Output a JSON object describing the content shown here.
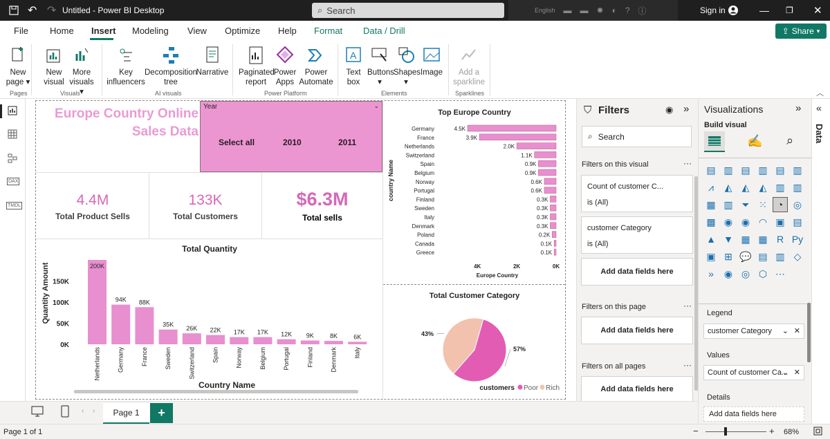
{
  "app": {
    "title": "Untitled - Power BI Desktop",
    "search_placeholder": "Search",
    "language": "English",
    "sign_in": "Sign in"
  },
  "menu": {
    "tabs": [
      "File",
      "Home",
      "Insert",
      "Modeling",
      "View",
      "Optimize",
      "Help",
      "Format",
      "Data / Drill"
    ],
    "active": "Insert",
    "share": "Share"
  },
  "ribbon": {
    "buttons": [
      {
        "label": "New page",
        "lines": [
          "New",
          "page ▾"
        ]
      },
      {
        "label": "New visual",
        "lines": [
          "New",
          "visual"
        ]
      },
      {
        "label": "More visuals",
        "lines": [
          "More",
          "visuals ▾"
        ]
      },
      {
        "label": "Key influencers",
        "lines": [
          "Key",
          "influencers"
        ]
      },
      {
        "label": "Decomposition tree",
        "lines": [
          "Decomposition",
          "tree"
        ]
      },
      {
        "label": "Narrative",
        "lines": [
          "Narrative",
          ""
        ]
      },
      {
        "label": "Paginated report",
        "lines": [
          "Paginated",
          "report"
        ]
      },
      {
        "label": "Power Apps",
        "lines": [
          "Power",
          "Apps"
        ]
      },
      {
        "label": "Power Automate",
        "lines": [
          "Power",
          "Automate"
        ]
      },
      {
        "label": "Text box",
        "lines": [
          "Text",
          "box"
        ]
      },
      {
        "label": "Buttons",
        "lines": [
          "Buttons",
          "▾"
        ]
      },
      {
        "label": "Shapes",
        "lines": [
          "Shapes",
          "▾"
        ]
      },
      {
        "label": "Image",
        "lines": [
          "Image",
          ""
        ]
      },
      {
        "label": "Add a sparkline",
        "lines": [
          "Add a",
          "sparkline"
        ]
      }
    ],
    "groups": [
      "Pages",
      "Visuals",
      "AI visuals",
      "Power Platform",
      "Elements",
      "Sparklines"
    ]
  },
  "report": {
    "title_line1": "Europe Country Online",
    "title_line2": "Sales Data",
    "slicer": {
      "header": "Year",
      "items": [
        "Select all",
        "2010",
        "2011"
      ]
    },
    "kpis": [
      {
        "value": "4.4M",
        "label": "Total Product Sells"
      },
      {
        "value": "133K",
        "label": "Total Customers"
      },
      {
        "value": "$6.3M",
        "label": "Total sells"
      }
    ]
  },
  "chart_data": [
    {
      "type": "bar",
      "title": "Total Quantity",
      "xlabel": "Country Name",
      "ylabel": "Quantity Amount",
      "categories": [
        "Netherlands",
        "Germany",
        "France",
        "Sweden",
        "Switzerland",
        "Spain",
        "Norway",
        "Belgium",
        "Portugal",
        "Finland",
        "Denmark",
        "Italy"
      ],
      "values": [
        200,
        94,
        88,
        35,
        26,
        22,
        17,
        17,
        12,
        9,
        8,
        6
      ],
      "data_labels": [
        "200K",
        "94K",
        "88K",
        "35K",
        "26K",
        "22K",
        "17K",
        "17K",
        "12K",
        "9K",
        "8K",
        "6K"
      ],
      "yticks": [
        "0K",
        "50K",
        "100K",
        "150K"
      ],
      "ylim": [
        0,
        200
      ],
      "color": "#e88fcf"
    },
    {
      "type": "bar",
      "orientation": "horizontal",
      "title": "Top Europe Country",
      "xlabel": "Europe Country",
      "ylabel": "country Name",
      "categories": [
        "Germany",
        "France",
        "Netherlands",
        "Switzerland",
        "Spain",
        "Belgium",
        "Norway",
        "Portugal",
        "Finland",
        "Sweden",
        "Italy",
        "Denmark",
        "Poland",
        "Canada",
        "Greece"
      ],
      "values": [
        4.5,
        3.9,
        2.0,
        1.1,
        0.9,
        0.9,
        0.6,
        0.6,
        0.3,
        0.3,
        0.3,
        0.3,
        0.2,
        0.1,
        0.1
      ],
      "data_labels": [
        "4.5K",
        "3.9K",
        "2.0K",
        "1.1K",
        "0.9K",
        "0.9K",
        "0.6K",
        "0.6K",
        "0.3K",
        "0.3K",
        "0.3K",
        "0.3K",
        "0.2K",
        "0.1K",
        "0.1K"
      ],
      "xticks": [
        "4K",
        "2K",
        "0K"
      ],
      "xlim": [
        0,
        4.5
      ],
      "reversed": true,
      "color": "#e88fcf"
    },
    {
      "type": "pie",
      "title": "Total Customer Category",
      "legend_title": "customers",
      "slices": [
        {
          "name": "Poor",
          "value": 57,
          "label": "57%",
          "color": "#e35cb4"
        },
        {
          "name": "Rich",
          "value": 43,
          "label": "43%",
          "color": "#f2c2ae"
        }
      ]
    }
  ],
  "filters": {
    "title": "Filters",
    "search_placeholder": "Search",
    "on_visual": "Filters on this visual",
    "cards": [
      {
        "name": "Count of customer C...",
        "value": "is (All)"
      },
      {
        "name": "customer Category",
        "value": "is (All)"
      }
    ],
    "add_fields": "Add data fields here",
    "on_page": "Filters on this page",
    "on_all": "Filters on all pages"
  },
  "viz": {
    "title": "Visualizations",
    "build": "Build visual",
    "legend_label": "Legend",
    "legend_value": "customer Category",
    "values_label": "Values",
    "values_value": "Count of customer Ca...",
    "details_label": "Details",
    "details_add": "Add data fields here"
  },
  "datapane": {
    "label": "Data"
  },
  "pages": {
    "tab": "Page 1",
    "add": "+"
  },
  "status": {
    "page": "Page 1 of 1",
    "zoom": "68%"
  }
}
